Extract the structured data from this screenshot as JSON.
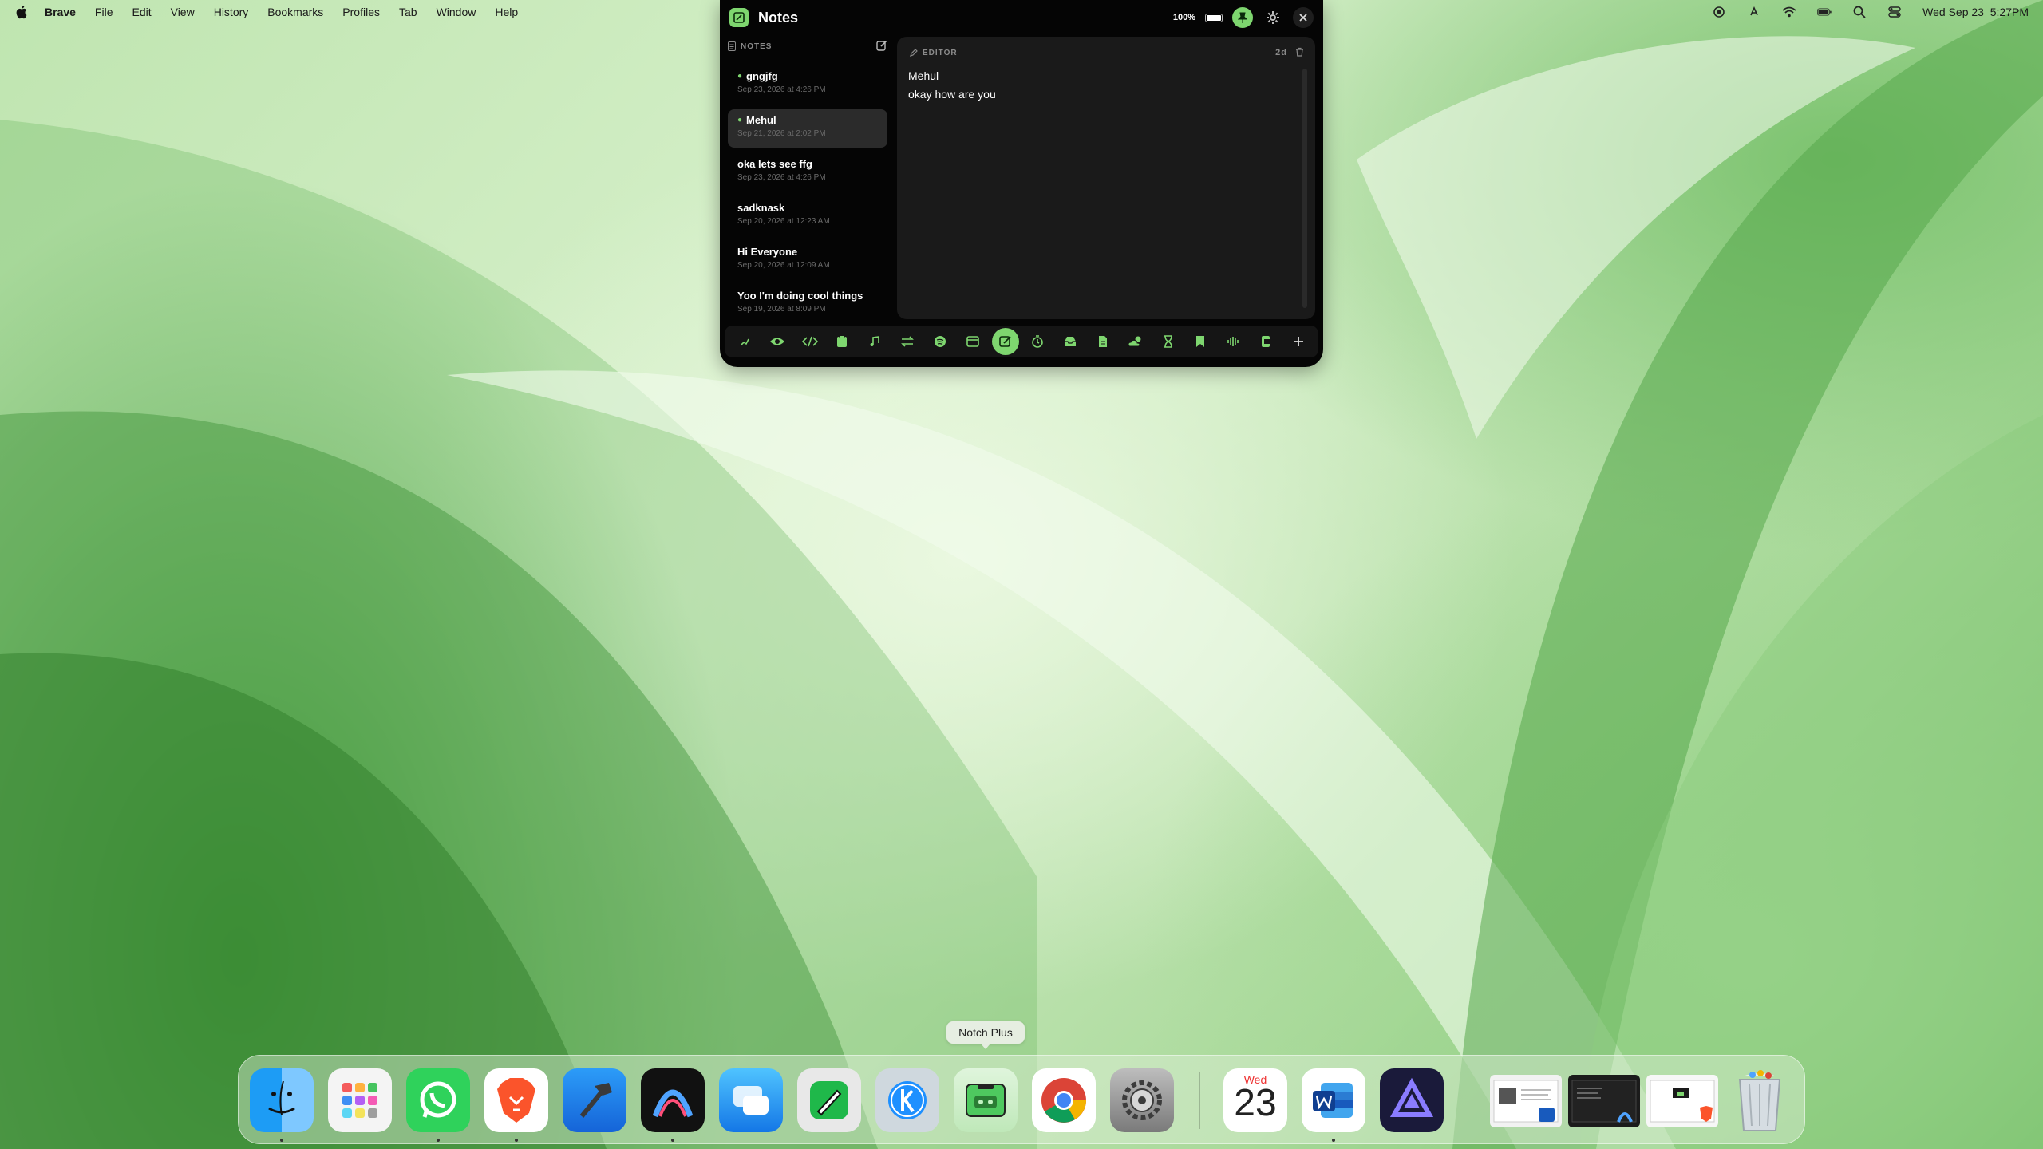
{
  "menubar": {
    "app_name": "Brave",
    "items": [
      "File",
      "Edit",
      "View",
      "History",
      "Bookmarks",
      "Profiles",
      "Tab",
      "Window",
      "Help"
    ],
    "clock": "Wed Sep 23  5:27PM"
  },
  "notch": {
    "title": "Notes",
    "battery_pct": "100%",
    "battery_level": 1.0,
    "accent_color": "#7ed66f"
  },
  "sidebar": {
    "header": "NOTES",
    "notes": [
      {
        "title": "gngjfg",
        "date": "Sep 23, 2026 at 4:26 PM",
        "pinned": true,
        "selected": false
      },
      {
        "title": "Mehul",
        "date": "Sep 21, 2026 at 2:02 PM",
        "pinned": true,
        "selected": true
      },
      {
        "title": "oka lets see ffg",
        "date": "Sep 23, 2026 at 4:26 PM",
        "pinned": false,
        "selected": false
      },
      {
        "title": "sadknask",
        "date": "Sep 20, 2026 at 12:23 AM",
        "pinned": false,
        "selected": false
      },
      {
        "title": "Hi Everyone",
        "date": "Sep 20, 2026 at 12:09 AM",
        "pinned": false,
        "selected": false
      },
      {
        "title": "Yoo I'm doing cool things",
        "date": "Sep 19, 2026 at 8:09 PM",
        "pinned": false,
        "selected": false
      }
    ]
  },
  "editor": {
    "header": "EDITOR",
    "age": "2d",
    "lines": [
      "Mehul",
      "okay how are you"
    ]
  },
  "toolbar": {
    "tools": [
      "chart-icon",
      "eye-icon",
      "code-icon",
      "clipboard-icon",
      "music-icon",
      "swap-icon",
      "spotify-icon",
      "calendar-icon",
      "notes-icon",
      "timer-icon",
      "tray-icon",
      "file-icon",
      "weather-icon",
      "hourglass-icon",
      "bookmark-icon",
      "waveform-icon",
      "extension-icon",
      "plus-icon"
    ],
    "active_index": 8
  },
  "tooltip": "Notch Plus",
  "dock": {
    "apps": [
      "Finder",
      "Launchpad",
      "WhatsApp",
      "Brave Browser",
      "Xcode",
      "Arc",
      "Microsoft Remote",
      "Notes Editor",
      "Klack",
      "Notch Plus",
      "Google Chrome",
      "System Settings"
    ],
    "calendar_day": "Wed",
    "calendar_date": "23",
    "more_apps": [
      "Calendar",
      "Microsoft Word",
      "Affinity"
    ],
    "windows": [
      "Word window",
      "Arc window",
      "Brave window"
    ],
    "trash": "Trash"
  }
}
